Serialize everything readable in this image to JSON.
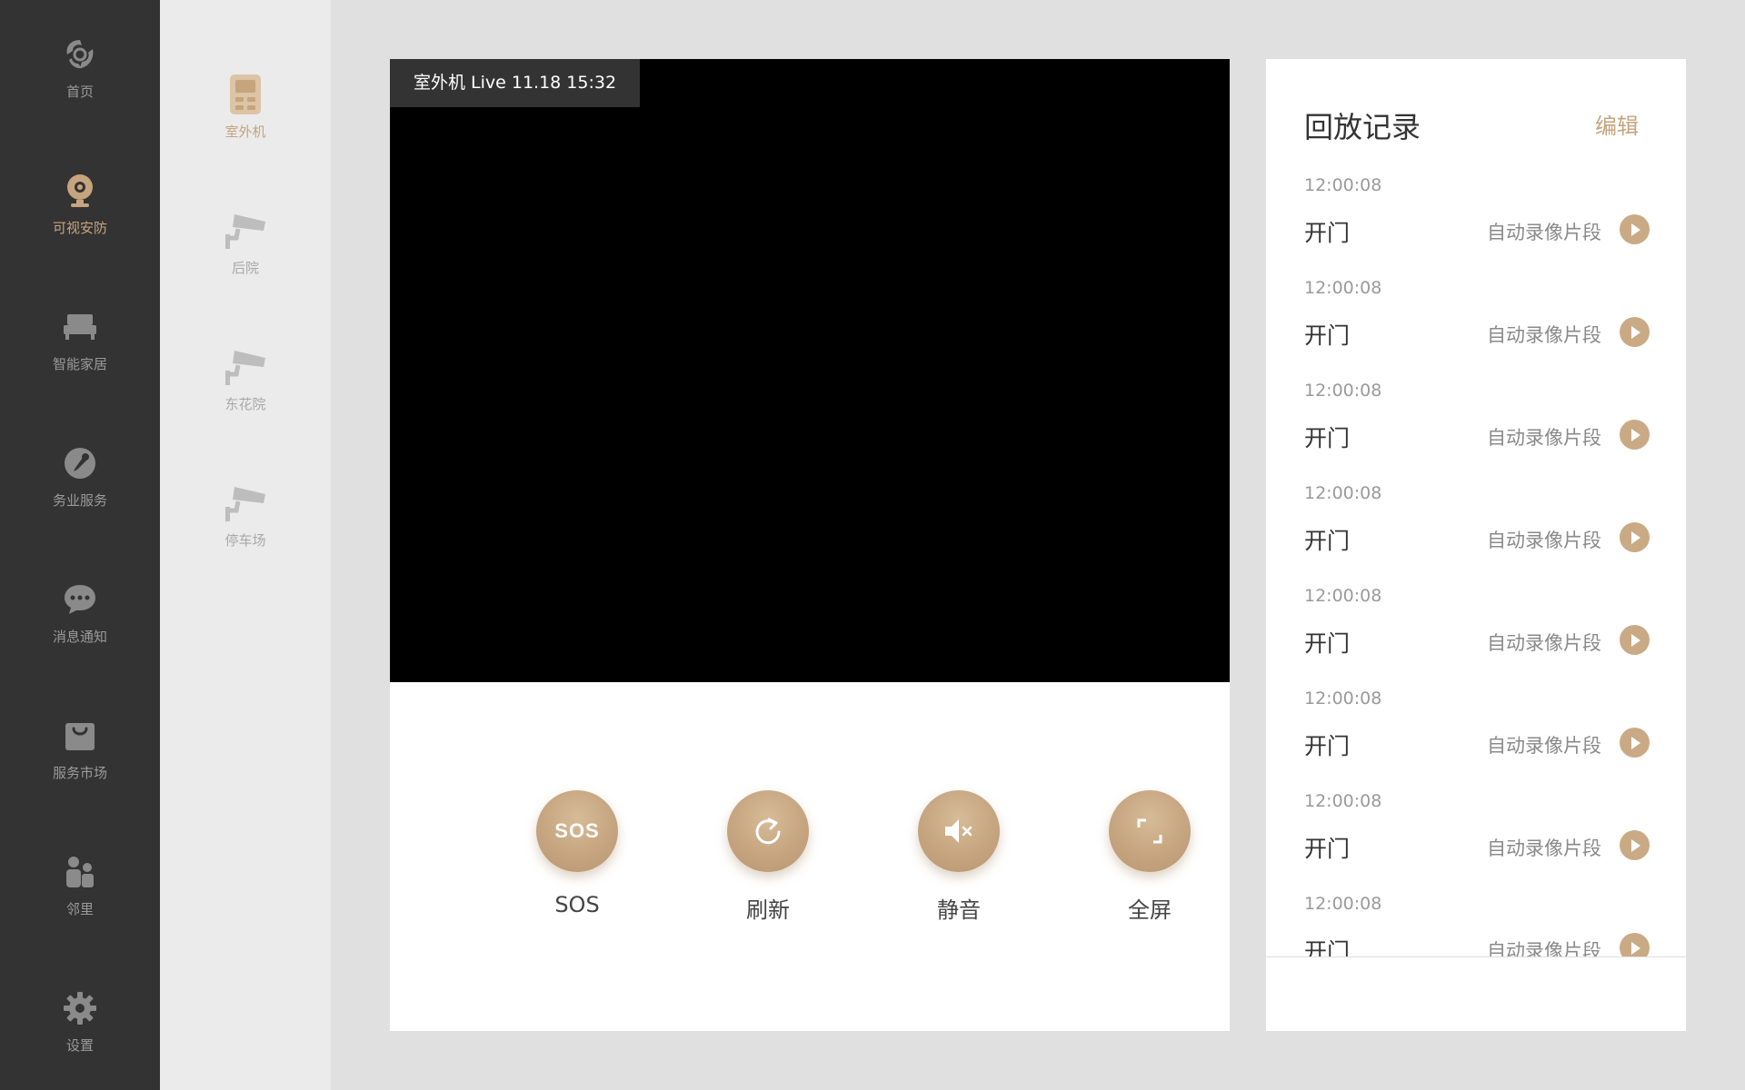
{
  "nav": {
    "items": [
      {
        "label": "首页",
        "icon": "home-logo-icon",
        "active": false
      },
      {
        "label": "可视安防",
        "icon": "camera-icon",
        "active": true
      },
      {
        "label": "智能家居",
        "icon": "bed-icon",
        "active": false
      },
      {
        "label": "务业服务",
        "icon": "wrench-icon",
        "active": false
      },
      {
        "label": "消息通知",
        "icon": "message-icon",
        "active": false
      },
      {
        "label": "服务市场",
        "icon": "shopping-bag-icon",
        "active": false
      },
      {
        "label": "邻里",
        "icon": "people-icon",
        "active": false
      },
      {
        "label": "设置",
        "icon": "gear-icon",
        "active": false
      }
    ]
  },
  "devices": {
    "items": [
      {
        "label": "室外机",
        "icon": "intercom-icon",
        "active": true
      },
      {
        "label": "后院",
        "icon": "cctv-camera-icon",
        "active": false
      },
      {
        "label": "东花院",
        "icon": "cctv-camera-icon",
        "active": false
      },
      {
        "label": "停车场",
        "icon": "cctv-camera-icon",
        "active": false
      }
    ]
  },
  "video": {
    "live_label": "室外机 Live 11.18 15:32"
  },
  "controls": {
    "sos_icon_text": "SOS",
    "sos": "SOS",
    "refresh": "刷新",
    "mute": "静音",
    "fullscreen": "全屏"
  },
  "playback": {
    "title": "回放记录",
    "edit": "编辑",
    "records": [
      {
        "time": "12:00:08",
        "action": "开门",
        "desc": "自动录像片段"
      },
      {
        "time": "12:00:08",
        "action": "开门",
        "desc": "自动录像片段"
      },
      {
        "time": "12:00:08",
        "action": "开门",
        "desc": "自动录像片段"
      },
      {
        "time": "12:00:08",
        "action": "开门",
        "desc": "自动录像片段"
      },
      {
        "time": "12:00:08",
        "action": "开门",
        "desc": "自动录像片段"
      },
      {
        "time": "12:00:08",
        "action": "开门",
        "desc": "自动录像片段"
      },
      {
        "time": "12:00:08",
        "action": "开门",
        "desc": "自动录像片段"
      },
      {
        "time": "12:00:08",
        "action": "开门",
        "desc": "自动录像片段"
      }
    ]
  },
  "colors": {
    "accent": "#c5a47e",
    "nav_bg": "#333333",
    "device_bg": "#ebebeb",
    "page_bg": "#e0e0e0"
  }
}
